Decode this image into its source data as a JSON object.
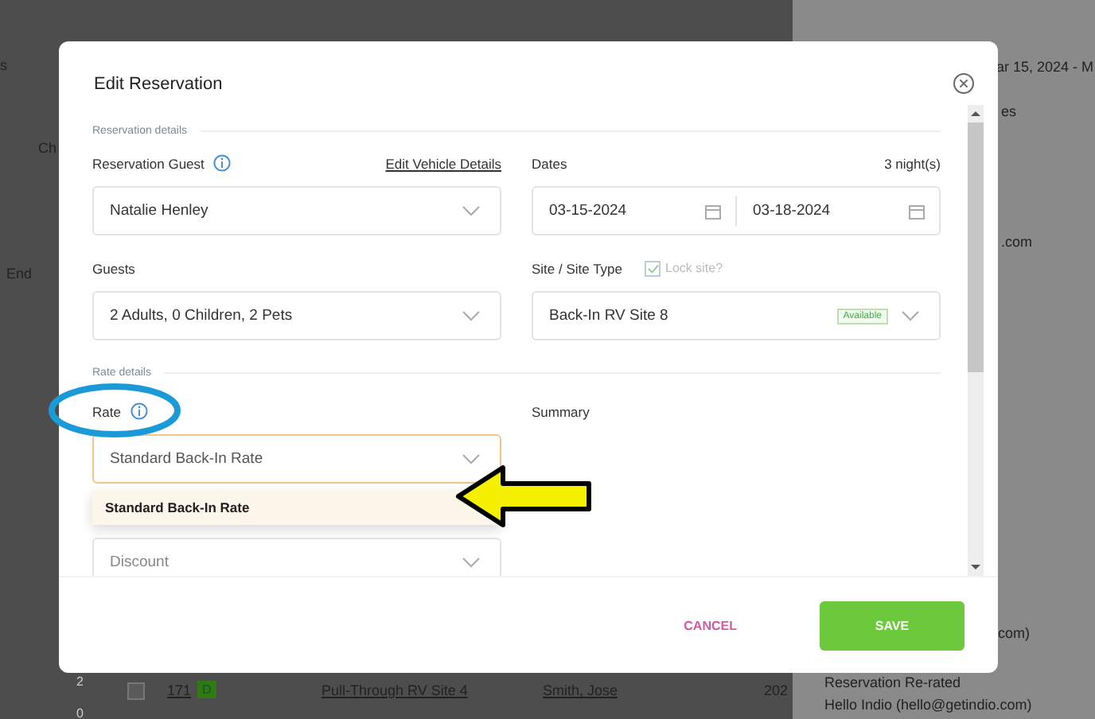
{
  "background": {
    "left_texts": [
      "s",
      "Ch",
      "End"
    ],
    "right_texts": [
      "ar 15, 2024 - M",
      "es",
      ".com",
      "com)",
      "Reservation Re-rated",
      "Hello Indio (hello@getindio.com)"
    ],
    "row": {
      "checked": false,
      "counts": [
        "2",
        "0"
      ],
      "number": "171",
      "badge": "D",
      "site": "Pull-Through RV Site 4",
      "guest": "Smith, Jose",
      "year": "202"
    }
  },
  "dialog": {
    "title": "Edit Reservation",
    "reservation_details": {
      "heading": "Reservation details",
      "guest": {
        "label": "Reservation Guest",
        "link": "Edit Vehicle Details",
        "value": "Natalie Henley"
      },
      "dates": {
        "label": "Dates",
        "nights": "3 night(s)",
        "start": "03-15-2024",
        "end": "03-18-2024"
      },
      "guests": {
        "label": "Guests",
        "value": "2 Adults, 0 Children, 2 Pets"
      },
      "site": {
        "label": "Site / Site Type",
        "lock_label": "Lock site?",
        "lock_checked": true,
        "value": "Back-In RV Site 8",
        "badge": "Available"
      }
    },
    "rate_details": {
      "heading": "Rate details",
      "rate": {
        "label": "Rate",
        "value": "Standard Back-In Rate",
        "expanded": true,
        "options": [
          {
            "label": "Standard Back-In Rate",
            "selected": true
          }
        ]
      },
      "summary": {
        "label": "Summary"
      },
      "discount": {
        "placeholder": "Discount"
      }
    },
    "buttons": {
      "cancel": "CANCEL",
      "save": "SAVE"
    }
  }
}
